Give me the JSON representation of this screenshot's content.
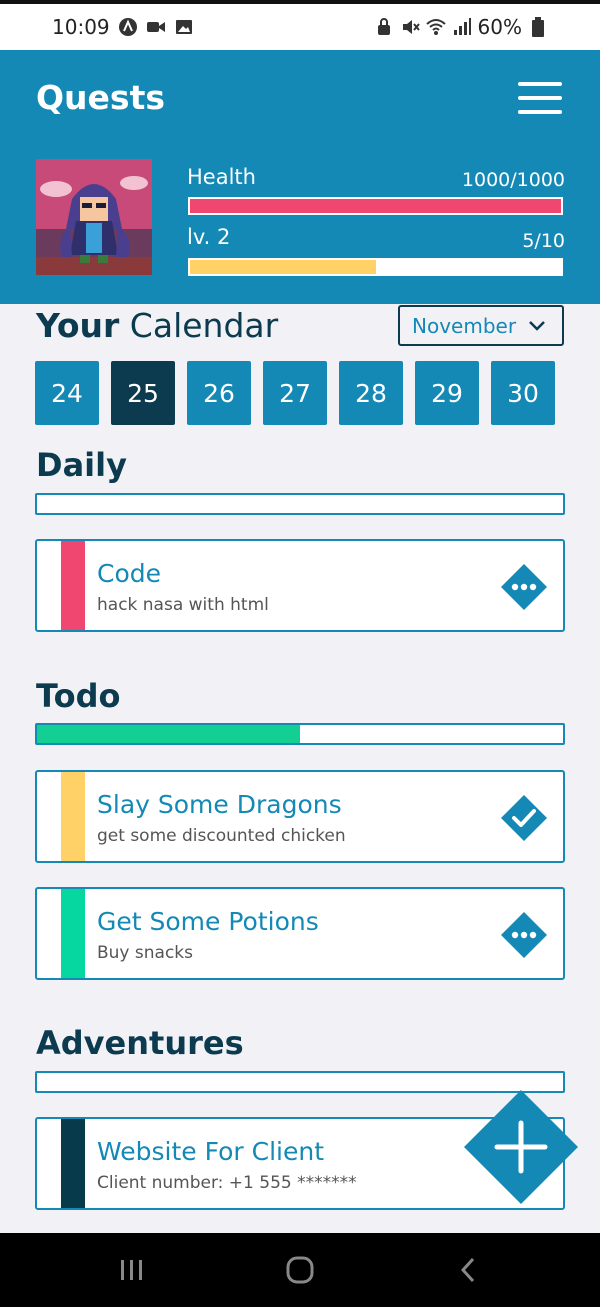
{
  "status_bar": {
    "time": "10:09",
    "battery": "60%"
  },
  "header": {
    "title": "Quests",
    "health_label": "Health",
    "health_value": "1000/1000",
    "health_fraction": 1.0,
    "level_label": "lv. 2",
    "xp_value": "5/10",
    "xp_fraction": 0.5
  },
  "calendar": {
    "title_bold": "Your",
    "title_rest": " Calendar",
    "month": "November",
    "days": [
      "24",
      "25",
      "26",
      "27",
      "28",
      "29",
      "30"
    ],
    "selected_day": "25"
  },
  "sections": {
    "daily": {
      "title": "Daily",
      "progress": 0.0,
      "tasks": [
        {
          "title": "Code",
          "subtitle": "hack nasa with html",
          "color": "#ef476f",
          "status": "pending"
        }
      ]
    },
    "todo": {
      "title": "Todo",
      "progress": 0.5,
      "tasks": [
        {
          "title": "Slay Some Dragons",
          "subtitle": "get some discounted chicken",
          "color": "#ffd166",
          "status": "done"
        },
        {
          "title": "Get Some Potions",
          "subtitle": "Buy snacks",
          "color": "#06d6a0",
          "status": "pending"
        }
      ]
    },
    "adventures": {
      "title": "Adventures",
      "progress": 0.0,
      "tasks": [
        {
          "title": "Website For Client",
          "subtitle": "Client number: +1 555 *******",
          "color": "#073b4c",
          "status": "pending"
        }
      ]
    }
  },
  "colors": {
    "primary": "#1489b6",
    "dark": "#0c3a4f",
    "health": "#ef476f",
    "xp": "#ffd166",
    "progress": "#14cf93"
  },
  "icons": {
    "menu": "hamburger-menu-icon",
    "add": "plus-icon",
    "options": "more-options-icon",
    "check": "check-icon"
  }
}
